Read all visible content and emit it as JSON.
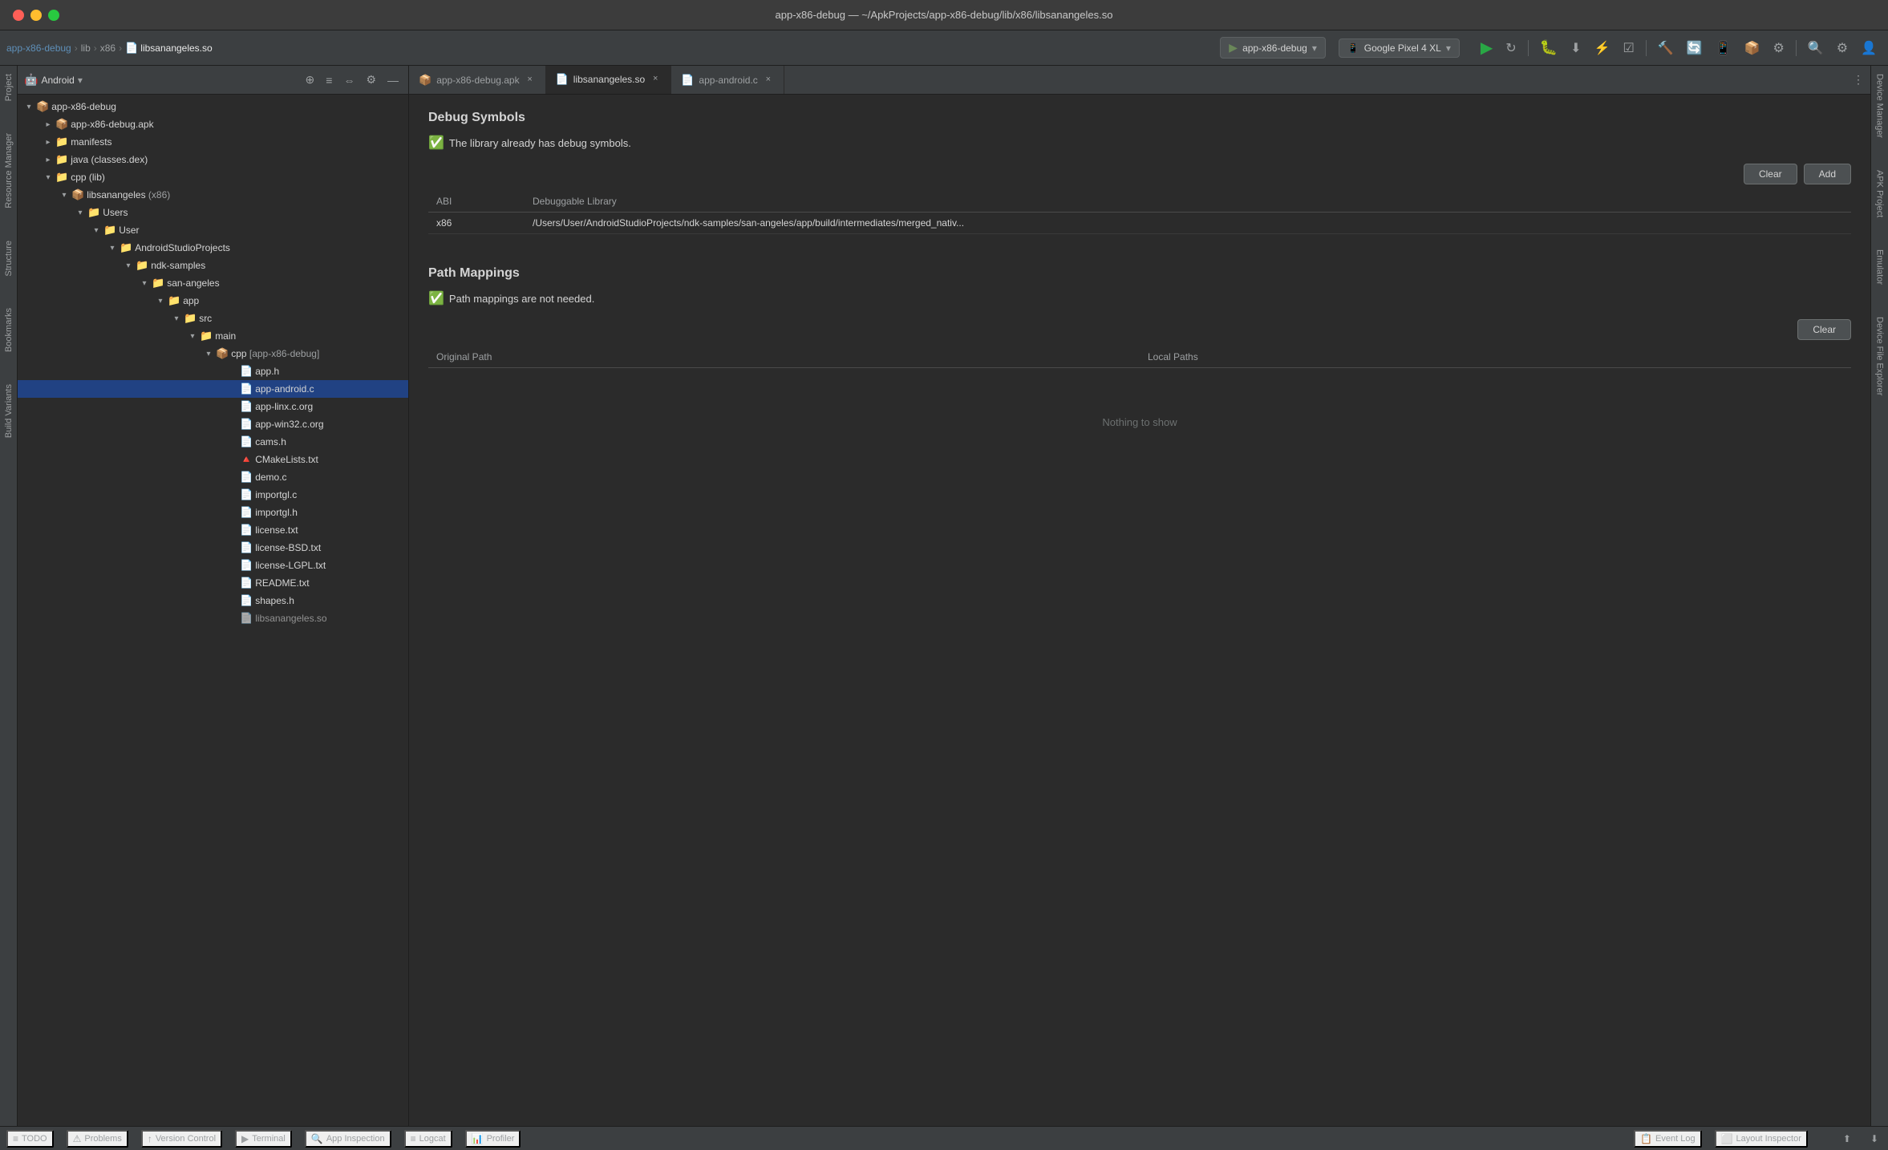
{
  "titleBar": {
    "title": "app-x86-debug — ~/ApkProjects/app-x86-debug/lib/x86/libsanangeles.so"
  },
  "breadcrumb": {
    "items": [
      "app-x86-debug",
      "lib",
      "x86",
      "libsanangeles.so"
    ]
  },
  "deviceSelector": {
    "appName": "app-x86-debug",
    "deviceName": "Google Pixel 4 XL"
  },
  "sidebar": {
    "header": {
      "dropdown": "Android"
    },
    "tree": [
      {
        "level": 0,
        "type": "module",
        "label": "app-x86-debug",
        "expanded": true
      },
      {
        "level": 1,
        "type": "apk",
        "label": "app-x86-debug.apk",
        "expanded": false
      },
      {
        "level": 1,
        "type": "folder",
        "label": "manifests",
        "expanded": false
      },
      {
        "level": 1,
        "type": "folder",
        "label": "java (classes.dex)",
        "expanded": false
      },
      {
        "level": 1,
        "type": "folder",
        "label": "cpp (lib)",
        "expanded": true
      },
      {
        "level": 2,
        "type": "module",
        "label": "libsanangeles (x86)",
        "expanded": true,
        "badge": "x86"
      },
      {
        "level": 3,
        "type": "folder",
        "label": "Users",
        "expanded": true
      },
      {
        "level": 4,
        "type": "folder",
        "label": "User",
        "expanded": true
      },
      {
        "level": 5,
        "type": "folder",
        "label": "AndroidStudioProjects",
        "expanded": true
      },
      {
        "level": 6,
        "type": "folder",
        "label": "ndk-samples",
        "expanded": true
      },
      {
        "level": 7,
        "type": "folder",
        "label": "san-angeles",
        "expanded": true
      },
      {
        "level": 8,
        "type": "folder",
        "label": "app",
        "expanded": true
      },
      {
        "level": 9,
        "type": "folder",
        "label": "src",
        "expanded": true
      },
      {
        "level": 10,
        "type": "folder",
        "label": "main",
        "expanded": true
      },
      {
        "level": 11,
        "type": "module",
        "label": "cpp [app-x86-debug]",
        "expanded": true
      },
      {
        "level": 12,
        "type": "fileH",
        "label": "app.h"
      },
      {
        "level": 12,
        "type": "fileC",
        "label": "app-android.c",
        "selected": true
      },
      {
        "level": 12,
        "type": "fileC",
        "label": "app-linx.c.org"
      },
      {
        "level": 12,
        "type": "fileC",
        "label": "app-win32.c.org"
      },
      {
        "level": 12,
        "type": "fileH",
        "label": "cams.h"
      },
      {
        "level": 12,
        "type": "cmake",
        "label": "CMakeLists.txt"
      },
      {
        "level": 12,
        "type": "fileC",
        "label": "demo.c"
      },
      {
        "level": 12,
        "type": "fileC",
        "label": "importgl.c"
      },
      {
        "level": 12,
        "type": "fileH",
        "label": "importgl.h"
      },
      {
        "level": 12,
        "type": "fileTxt",
        "label": "license.txt"
      },
      {
        "level": 12,
        "type": "fileTxt",
        "label": "license-BSD.txt"
      },
      {
        "level": 12,
        "type": "fileTxt",
        "label": "license-LGPL.txt"
      },
      {
        "level": 12,
        "type": "fileTxt",
        "label": "README.txt"
      },
      {
        "level": 12,
        "type": "fileH",
        "label": "shapes.h"
      },
      {
        "level": 12,
        "type": "fileC",
        "label": "libsanangeles.so"
      }
    ]
  },
  "fileTabs": {
    "tabs": [
      {
        "label": "app-x86-debug.apk",
        "type": "apk",
        "active": false
      },
      {
        "label": "libsanangeles.so",
        "type": "so",
        "active": true
      },
      {
        "label": "app-android.c",
        "type": "c",
        "active": false
      }
    ]
  },
  "debugSymbols": {
    "title": "Debug Symbols",
    "statusMessage": "The library already has debug symbols.",
    "clearButton": "Clear",
    "addButton": "Add",
    "table": {
      "headers": [
        "ABI",
        "Debuggable Library"
      ],
      "rows": [
        {
          "abi": "x86",
          "library": "/Users/User/AndroidStudioProjects/ndk-samples/san-angeles/app/build/intermediates/merged_nativ..."
        }
      ]
    }
  },
  "pathMappings": {
    "title": "Path Mappings",
    "statusMessage": "Path mappings are not needed.",
    "clearButton": "Clear",
    "table": {
      "headers": [
        "Original Path",
        "Local Paths"
      ],
      "emptyMessage": "Nothing to show"
    }
  },
  "rightPanels": {
    "deviceManager": "Device Manager",
    "apkProject": "APK Project",
    "emulator": "Emulator",
    "deviceFileExplorer": "Device File Explorer"
  },
  "leftPanels": {
    "project": "Project",
    "resourceManager": "Resource Manager",
    "structure": "Structure",
    "bookmarks": "Bookmarks",
    "buildVariants": "Build Variants"
  },
  "bottomBar": {
    "todo": "TODO",
    "problems": "Problems",
    "versionControl": "Version Control",
    "terminal": "Terminal",
    "appInspection": "App Inspection",
    "logcat": "Logcat",
    "profiler": "Profiler",
    "eventLog": "Event Log",
    "layoutInspector": "Layout Inspector"
  }
}
